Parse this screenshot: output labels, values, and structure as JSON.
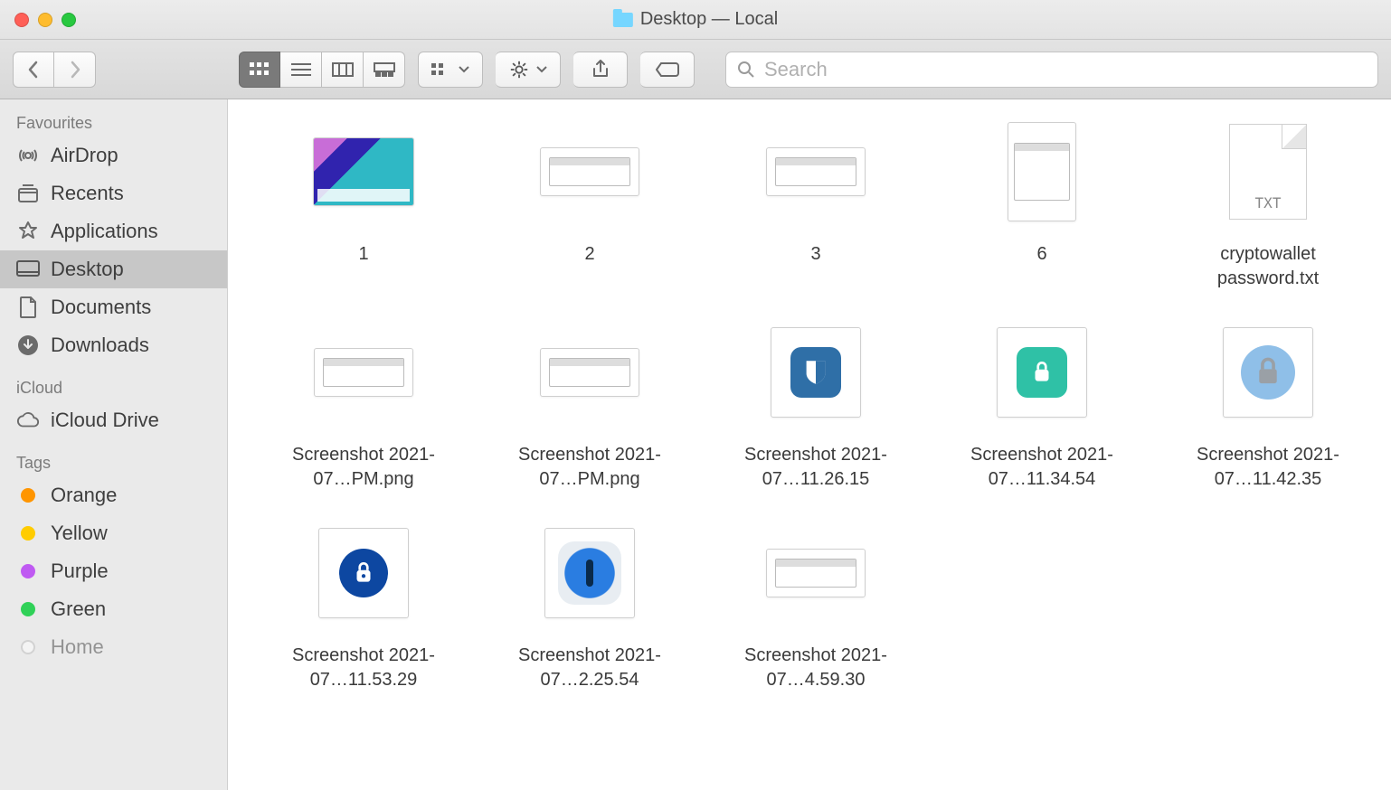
{
  "window": {
    "title": "Desktop — Local"
  },
  "toolbar": {
    "search_placeholder": "Search"
  },
  "sidebar": {
    "sections": [
      {
        "header": "Favourites",
        "items": [
          {
            "icon": "airdrop",
            "label": "AirDrop",
            "active": false
          },
          {
            "icon": "recents",
            "label": "Recents",
            "active": false
          },
          {
            "icon": "apps",
            "label": "Applications",
            "active": false
          },
          {
            "icon": "desktop",
            "label": "Desktop",
            "active": true
          },
          {
            "icon": "documents",
            "label": "Documents",
            "active": false
          },
          {
            "icon": "downloads",
            "label": "Downloads",
            "active": false
          }
        ]
      },
      {
        "header": "iCloud",
        "items": [
          {
            "icon": "icloud",
            "label": "iCloud Drive",
            "active": false
          }
        ]
      },
      {
        "header": "Tags",
        "items": [
          {
            "icon": "tag",
            "color": "#ff9500",
            "label": "Orange",
            "active": false
          },
          {
            "icon": "tag",
            "color": "#ffcc00",
            "label": "Yellow",
            "active": false
          },
          {
            "icon": "tag",
            "color": "#bf5af2",
            "label": "Purple",
            "active": false
          },
          {
            "icon": "tag",
            "color": "#30d158",
            "label": "Green",
            "active": false
          },
          {
            "icon": "tag",
            "color": "#d0d0d0",
            "label": "Home",
            "active": false
          }
        ]
      }
    ]
  },
  "files": [
    {
      "name": "1",
      "kind": "image",
      "thumb": "scene1",
      "shape": "wide"
    },
    {
      "name": "2",
      "kind": "image",
      "thumb": "win",
      "shape": "mid"
    },
    {
      "name": "3",
      "kind": "image",
      "thumb": "win",
      "shape": "mid"
    },
    {
      "name": "6",
      "kind": "image",
      "thumb": "win",
      "shape": "tall"
    },
    {
      "name": "cryptowallet password.txt",
      "kind": "txt",
      "thumb": "txt",
      "shape": "tall",
      "badge": "TXT"
    },
    {
      "name": "Screenshot 2021-07…PM.png",
      "kind": "image",
      "thumb": "win",
      "shape": "mid"
    },
    {
      "name": "Screenshot 2021-07…PM.png",
      "kind": "image",
      "thumb": "win",
      "shape": "mid"
    },
    {
      "name": "Screenshot 2021-07…11.26.15",
      "kind": "image",
      "thumb": "bitwarden",
      "shape": "square"
    },
    {
      "name": "Screenshot 2021-07…11.34.54",
      "kind": "image",
      "thumb": "teal",
      "shape": "square"
    },
    {
      "name": "Screenshot 2021-07…11.42.35",
      "kind": "image",
      "thumb": "keychain",
      "shape": "square"
    },
    {
      "name": "Screenshot 2021-07…11.53.29",
      "kind": "image",
      "thumb": "enpass",
      "shape": "square"
    },
    {
      "name": "Screenshot 2021-07…2.25.54",
      "kind": "image",
      "thumb": "onepass",
      "shape": "square"
    },
    {
      "name": "Screenshot 2021-07…4.59.30",
      "kind": "image",
      "thumb": "win",
      "shape": "mid"
    }
  ]
}
